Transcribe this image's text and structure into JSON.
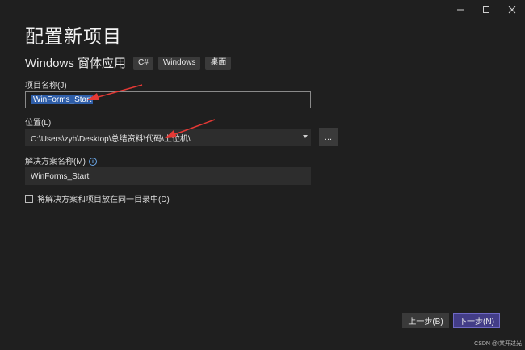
{
  "window": {
    "controls": [
      "minimize-icon",
      "maximize-icon",
      "close-icon"
    ]
  },
  "page": {
    "title": "配置新项目",
    "subtitle": "Windows 窗体应用",
    "tags": [
      "C#",
      "Windows",
      "桌面"
    ]
  },
  "project_name": {
    "label": "项目名称(J)",
    "value": "WinForms_Start"
  },
  "location": {
    "label": "位置(L)",
    "value": "C:\\Users\\zyh\\Desktop\\总结资料\\代码\\上位机\\",
    "browse_label": "..."
  },
  "solution_name": {
    "label": "解决方案名称(M)",
    "value": "WinForms_Start",
    "info_glyph": "i"
  },
  "same_dir_checkbox": {
    "label": "将解决方案和项目放在同一目录中(D)",
    "checked": false
  },
  "footer": {
    "prev_label": "上一步(B)",
    "next_label": "下一步(N)"
  },
  "annotation": {
    "arrow_color": "#e53935"
  },
  "watermark": "CSDN @I某开过光"
}
